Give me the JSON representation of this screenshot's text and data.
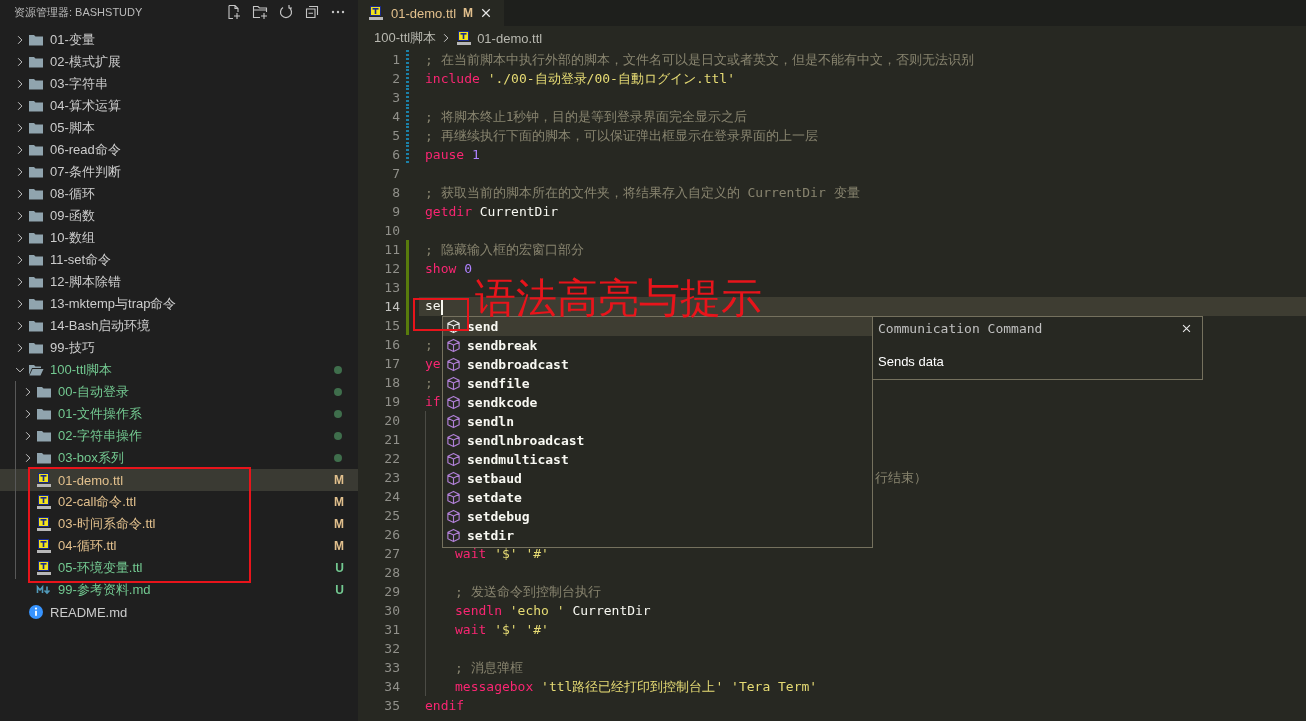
{
  "sidebar": {
    "title": "资源管理器: BASHSTUDY",
    "tree": [
      {
        "label": "01-变量",
        "kind": "folder",
        "expanded": false,
        "selected": false,
        "changed": false,
        "modified": false
      },
      {
        "label": "02-模式扩展",
        "kind": "folder",
        "expanded": false,
        "selected": false,
        "changed": false,
        "modified": false
      },
      {
        "label": "03-字符串",
        "kind": "folder",
        "expanded": false,
        "selected": false,
        "changed": false,
        "modified": false
      },
      {
        "label": "04-算术运算",
        "kind": "folder",
        "expanded": false,
        "selected": false,
        "changed": false,
        "modified": false
      },
      {
        "label": "05-脚本",
        "kind": "folder",
        "expanded": false,
        "selected": false,
        "changed": false,
        "modified": false
      },
      {
        "label": "06-read命令",
        "kind": "folder",
        "expanded": false,
        "selected": false,
        "changed": false,
        "modified": false
      },
      {
        "label": "07-条件判断",
        "kind": "folder",
        "expanded": false,
        "selected": false,
        "changed": false,
        "modified": false
      },
      {
        "label": "08-循环",
        "kind": "folder",
        "expanded": false,
        "selected": false,
        "changed": false,
        "modified": false
      },
      {
        "label": "09-函数",
        "kind": "folder",
        "expanded": false,
        "selected": false,
        "changed": false,
        "modified": false
      },
      {
        "label": "10-数组",
        "kind": "folder",
        "expanded": false,
        "selected": false,
        "changed": false,
        "modified": false
      },
      {
        "label": "11-set命令",
        "kind": "folder",
        "expanded": false,
        "selected": false,
        "changed": false,
        "modified": false
      },
      {
        "label": "12-脚本除错",
        "kind": "folder",
        "expanded": false,
        "selected": false,
        "changed": false,
        "modified": false
      },
      {
        "label": "13-mktemp与trap命令",
        "kind": "folder",
        "expanded": false,
        "selected": false,
        "changed": false,
        "modified": false
      },
      {
        "label": "14-Bash启动环境",
        "kind": "folder",
        "expanded": false,
        "selected": false,
        "changed": false,
        "modified": false
      },
      {
        "label": "99-技巧",
        "kind": "folder",
        "expanded": false,
        "selected": false,
        "changed": false,
        "modified": false
      },
      {
        "label": "100-ttl脚本",
        "kind": "folder",
        "expanded": true,
        "selected": false,
        "changed": true,
        "modified": false,
        "children": [
          {
            "label": "00-自动登录",
            "kind": "folder",
            "expanded": false,
            "selected": false,
            "changed": true,
            "modified": false
          },
          {
            "label": "01-文件操作系",
            "kind": "folder",
            "expanded": false,
            "selected": false,
            "changed": true,
            "modified": false
          },
          {
            "label": "02-字符串操作",
            "kind": "folder",
            "expanded": false,
            "selected": false,
            "changed": true,
            "modified": false
          },
          {
            "label": "03-box系列",
            "kind": "folder",
            "expanded": false,
            "selected": false,
            "changed": true,
            "modified": false
          },
          {
            "label": "01-demo.ttl",
            "kind": "ttl",
            "selected": true,
            "changed": false,
            "modified": true,
            "badge": "M"
          },
          {
            "label": "02-call命令.ttl",
            "kind": "ttl",
            "selected": false,
            "changed": false,
            "modified": true,
            "badge": "M"
          },
          {
            "label": "03-时间系命令.ttl",
            "kind": "ttl",
            "selected": false,
            "changed": false,
            "modified": true,
            "badge": "M"
          },
          {
            "label": "04-循环.ttl",
            "kind": "ttl",
            "selected": false,
            "changed": false,
            "modified": true,
            "badge": "M"
          },
          {
            "label": "05-环境变量.ttl",
            "kind": "ttl",
            "selected": false,
            "changed": true,
            "modified": false,
            "badge": "U"
          },
          {
            "label": "99-参考资料.md",
            "kind": "markdown",
            "selected": false,
            "changed": true,
            "modified": false,
            "badge": "U"
          }
        ]
      },
      {
        "label": "README.md",
        "kind": "info",
        "selected": false,
        "changed": false,
        "modified": false
      }
    ]
  },
  "editor": {
    "tab": {
      "label": "01-demo.ttl",
      "badge": "M",
      "modified": true
    },
    "breadcrumb": {
      "folder": "100-ttl脚本",
      "file": "01-demo.ttl"
    },
    "lines": [
      {
        "num": "1",
        "modified": true,
        "added": false,
        "current": false,
        "tokens": [
          {
            "kind": "comment",
            "text": "; 在当前脚本中执行外部的脚本，文件名可以是日文或者英文，但是不能有中文，否则无法识别"
          }
        ]
      },
      {
        "num": "2",
        "modified": true,
        "added": false,
        "current": false,
        "tokens": [
          {
            "kind": "keyword",
            "text": "include"
          },
          {
            "kind": "string",
            "text": "'./00-自动登录/00-自動ログイン.ttl'"
          }
        ]
      },
      {
        "num": "3",
        "modified": true,
        "added": false,
        "current": false
      },
      {
        "num": "4",
        "modified": true,
        "added": false,
        "current": false,
        "tokens": [
          {
            "kind": "comment",
            "text": "; 将脚本终止1秒钟，目的是等到登录界面完全显示之后"
          }
        ]
      },
      {
        "num": "5",
        "modified": true,
        "added": false,
        "current": false,
        "tokens": [
          {
            "kind": "comment",
            "text": "; 再继续执行下面的脚本，可以保证弹出框显示在登录界面的上一层"
          }
        ]
      },
      {
        "num": "6",
        "modified": true,
        "added": false,
        "current": false,
        "tokens": [
          {
            "kind": "keyword",
            "text": "pause"
          },
          {
            "kind": "number",
            "text": "1"
          }
        ]
      },
      {
        "num": "7",
        "modified": false,
        "added": false,
        "current": false
      },
      {
        "num": "8",
        "modified": false,
        "added": false,
        "current": false,
        "tokens": [
          {
            "kind": "comment",
            "text": "; 获取当前的脚本所在的文件夹，将结果存入自定义的 CurrentDir 变量"
          }
        ]
      },
      {
        "num": "9",
        "modified": false,
        "added": false,
        "current": false,
        "tokens": [
          {
            "kind": "keyword",
            "text": "getdir"
          },
          {
            "kind": "ident",
            "text": "CurrentDir"
          }
        ]
      },
      {
        "num": "10",
        "modified": false,
        "added": false,
        "current": false
      },
      {
        "num": "11",
        "modified": false,
        "added": true,
        "current": false,
        "tokens": [
          {
            "kind": "comment",
            "text": "; 隐藏输入框的宏窗口部分"
          }
        ]
      },
      {
        "num": "12",
        "modified": false,
        "added": true,
        "current": false,
        "tokens": [
          {
            "kind": "keyword",
            "text": "show"
          },
          {
            "kind": "number",
            "text": "0"
          }
        ]
      },
      {
        "num": "13",
        "modified": false,
        "added": true,
        "current": false
      },
      {
        "num": "14",
        "modified": false,
        "added": true,
        "current": true,
        "tokens": [
          {
            "kind": "ident",
            "text": "se"
          }
        ]
      },
      {
        "num": "15",
        "modified": false,
        "added": true,
        "current": false
      },
      {
        "num": "16",
        "modified": false,
        "added": false,
        "current": false,
        "tokens": [
          {
            "kind": "comment",
            "text": ";"
          }
        ]
      },
      {
        "num": "17",
        "modified": false,
        "added": false,
        "current": false,
        "tokens": [
          {
            "kind": "keyword",
            "text": "ye"
          }
        ]
      },
      {
        "num": "18",
        "modified": false,
        "added": false,
        "current": false,
        "tokens": [
          {
            "kind": "comment",
            "text": ";"
          }
        ]
      },
      {
        "num": "19",
        "modified": false,
        "added": false,
        "current": false,
        "tokens": [
          {
            "kind": "keyword",
            "text": "if"
          }
        ],
        "children": [
          {
            "num": "20",
            "modified": false,
            "added": false,
            "current": false
          },
          {
            "num": "21",
            "modified": false,
            "added": false,
            "current": false
          },
          {
            "num": "22",
            "modified": false,
            "added": false,
            "current": false
          },
          {
            "num": "23",
            "modified": false,
            "added": false,
            "current": false,
            "tokens": [
              {
                "kind": "tail",
                "text": "行结束）"
              }
            ]
          },
          {
            "num": "24",
            "modified": false,
            "added": false,
            "current": false
          },
          {
            "num": "25",
            "modified": false,
            "added": false,
            "current": false
          },
          {
            "num": "26",
            "modified": false,
            "added": false,
            "current": false
          },
          {
            "num": "27",
            "modified": false,
            "added": false,
            "current": false,
            "tokens": [
              {
                "kind": "keyword",
                "text": "wait"
              },
              {
                "kind": "string",
                "text": "'$'"
              },
              {
                "kind": "string",
                "text": "'#'"
              }
            ]
          },
          {
            "num": "28",
            "modified": false,
            "added": false,
            "current": false
          },
          {
            "num": "29",
            "modified": false,
            "added": false,
            "current": false,
            "tokens": [
              {
                "kind": "comment",
                "text": "; 发送命令到控制台执行"
              }
            ]
          },
          {
            "num": "30",
            "modified": false,
            "added": false,
            "current": false,
            "tokens": [
              {
                "kind": "keyword",
                "text": "sendln"
              },
              {
                "kind": "string",
                "text": "'echo '"
              },
              {
                "kind": "ident",
                "text": "CurrentDir"
              }
            ]
          },
          {
            "num": "31",
            "modified": false,
            "added": false,
            "current": false,
            "tokens": [
              {
                "kind": "keyword",
                "text": "wait"
              },
              {
                "kind": "string",
                "text": "'$'"
              },
              {
                "kind": "string",
                "text": "'#'"
              }
            ]
          },
          {
            "num": "32",
            "modified": false,
            "added": false,
            "current": false
          },
          {
            "num": "33",
            "modified": false,
            "added": false,
            "current": false,
            "tokens": [
              {
                "kind": "comment",
                "text": "; 消息弹框"
              }
            ]
          },
          {
            "num": "34",
            "modified": false,
            "added": false,
            "current": false,
            "tokens": [
              {
                "kind": "keyword",
                "text": "messagebox"
              },
              {
                "kind": "string",
                "text": "'ttl路径已经打印到控制台上'"
              },
              {
                "kind": "string",
                "text": "'Tera Term'"
              }
            ]
          }
        ]
      },
      {
        "num": "35",
        "modified": false,
        "added": false,
        "current": false,
        "tokens": [
          {
            "kind": "keyword",
            "text": "endif"
          }
        ]
      }
    ],
    "suggest": {
      "items": [
        {
          "label": "send",
          "selected": true
        },
        {
          "label": "sendbreak",
          "selected": false
        },
        {
          "label": "sendbroadcast",
          "selected": false
        },
        {
          "label": "sendfile",
          "selected": false
        },
        {
          "label": "sendkcode",
          "selected": false
        },
        {
          "label": "sendln",
          "selected": false
        },
        {
          "label": "sendlnbroadcast",
          "selected": false
        },
        {
          "label": "sendmulticast",
          "selected": false
        },
        {
          "label": "setbaud",
          "selected": false
        },
        {
          "label": "setdate",
          "selected": false
        },
        {
          "label": "setdebug",
          "selected": false
        },
        {
          "label": "setdir",
          "selected": false
        }
      ],
      "details": {
        "title": "Communication Command",
        "description": "Sends data"
      }
    }
  },
  "annotation": {
    "text": "语法高亮与提示"
  }
}
